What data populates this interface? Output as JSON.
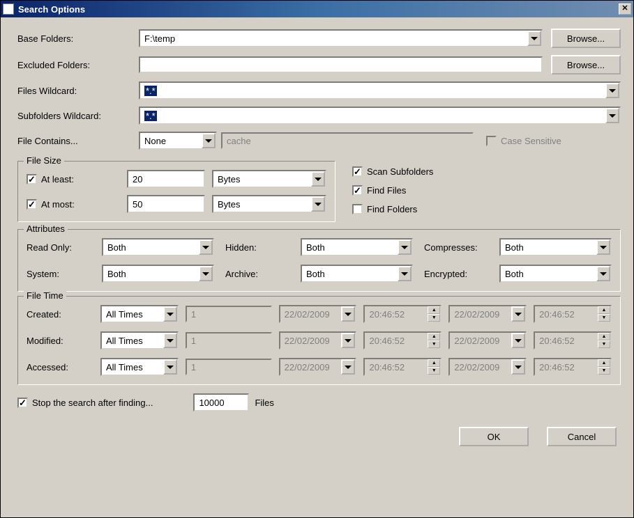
{
  "window": {
    "title": "Search Options"
  },
  "labels": {
    "base_folders": "Base Folders:",
    "excluded_folders": "Excluded Folders:",
    "files_wildcard": "Files Wildcard:",
    "subfolders_wildcard": "Subfolders Wildcard:",
    "file_contains": "File Contains...",
    "browse": "Browse...",
    "case_sensitive": "Case Sensitive",
    "file_size": "File Size",
    "at_least": "At least:",
    "at_most": "At most:",
    "bytes": "Bytes",
    "scan_subfolders": "Scan Subfolders",
    "find_files": "Find Files",
    "find_folders": "Find Folders",
    "attributes": "Attributes",
    "read_only": "Read Only:",
    "hidden": "Hidden:",
    "compresses": "Compresses:",
    "system": "System:",
    "archive": "Archive:",
    "encrypted": "Encrypted:",
    "both": "Both",
    "file_time": "File Time",
    "created": "Created:",
    "modified": "Modified:",
    "accessed": "Accessed:",
    "all_times": "All Times",
    "stop_after": "Stop the search after finding...",
    "files": "Files",
    "ok": "OK",
    "cancel": "Cancel"
  },
  "values": {
    "base_folders": "F:\\temp",
    "excluded_folders": "",
    "files_wildcard": "*.*",
    "subfolders_wildcard": "*.*",
    "file_contains": "None",
    "file_contains_placeholder": "cache",
    "at_least": "20",
    "at_most": "50",
    "ft_num": "1",
    "ft_date": "22/02/2009",
    "ft_time": "20:46:52",
    "stop_count": "10000"
  },
  "checks": {
    "at_least": "✓",
    "at_most": "✓",
    "scan_subfolders": "✓",
    "find_files": "✓",
    "find_folders": "",
    "case_sensitive": "",
    "stop_after": "✓"
  }
}
